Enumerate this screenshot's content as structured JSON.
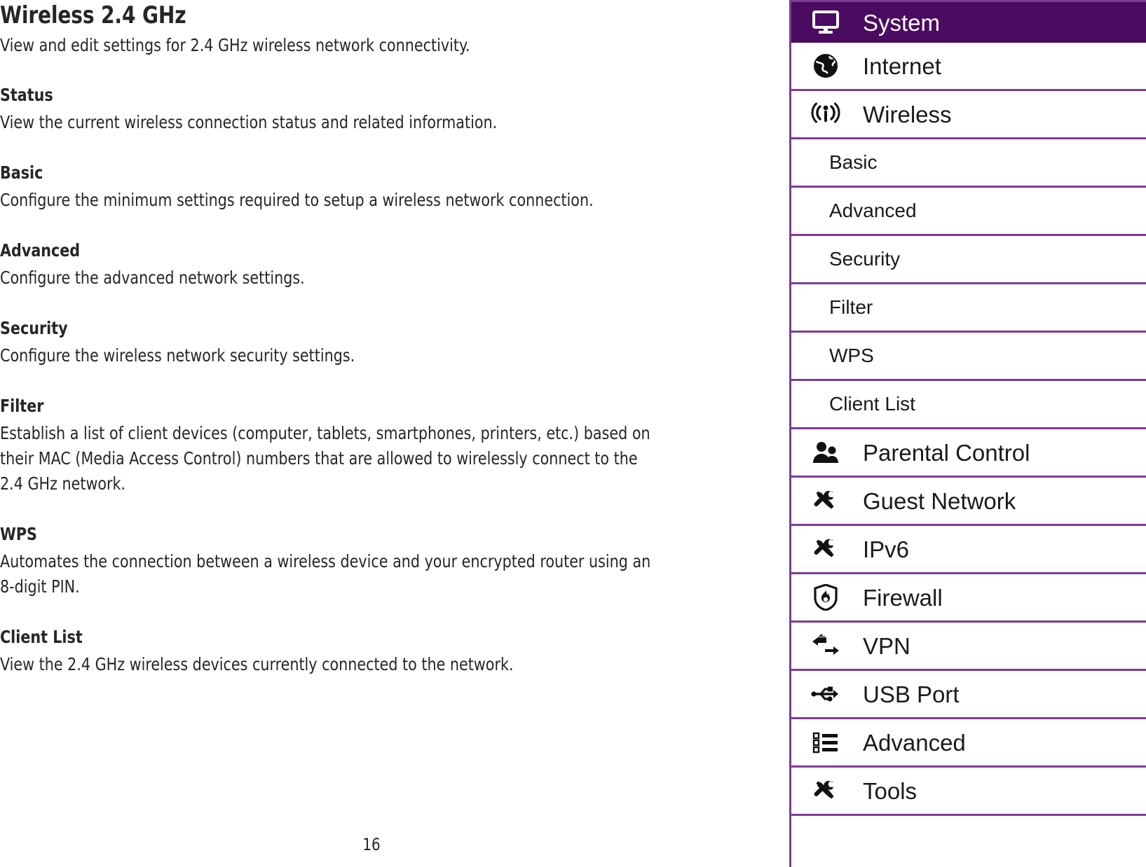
{
  "document": {
    "title": "Wireless 2.4 GHz",
    "intro": "View and edit settings for 2.4 GHz wireless network connectivity.",
    "page_number": "16",
    "sections": [
      {
        "heading": "Status",
        "body": "View the current wireless connection status and related information."
      },
      {
        "heading": "Basic",
        "body": "Configure the minimum settings required to setup a wireless network connection."
      },
      {
        "heading": "Advanced",
        "body": "Configure the advanced network settings."
      },
      {
        "heading": "Security",
        "body": "Configure the wireless network security settings."
      },
      {
        "heading": "Filter",
        "body": "Establish a list of client devices (computer, tablets, smartphones, printers, etc.) based on their MAC (Media Access Control) numbers that are allowed to wirelessly connect to the 2.4 GHz network."
      },
      {
        "heading": "WPS",
        "body": "Automates the connection between a wireless device and your encrypted router using an 8-digit PIN."
      },
      {
        "heading": "Client List",
        "body": "View the 2.4 GHz wireless devices currently connected to the network."
      }
    ]
  },
  "menu": {
    "accent_color": "#7E3C94",
    "active_color": "#4A0B60",
    "active_text_color": "#FFFFFF",
    "items": [
      {
        "label": "System",
        "icon": "monitor-icon",
        "level": "top",
        "active": true
      },
      {
        "label": "Internet",
        "icon": "globe-icon",
        "level": "top",
        "active": false
      },
      {
        "label": "Wireless",
        "icon": "wifi-signal-icon",
        "level": "top",
        "active": false
      },
      {
        "label": "Basic",
        "icon": null,
        "level": "sub",
        "active": false
      },
      {
        "label": "Advanced",
        "icon": null,
        "level": "sub",
        "active": false
      },
      {
        "label": "Security",
        "icon": null,
        "level": "sub",
        "active": false
      },
      {
        "label": "Filter",
        "icon": null,
        "level": "sub",
        "active": false
      },
      {
        "label": "WPS",
        "icon": null,
        "level": "sub",
        "active": false
      },
      {
        "label": "Client List",
        "icon": null,
        "level": "sub",
        "active": false
      },
      {
        "label": "Parental Control",
        "icon": "people-icon",
        "level": "top",
        "active": false
      },
      {
        "label": "Guest Network",
        "icon": "tools-icon",
        "level": "top",
        "active": false
      },
      {
        "label": "IPv6",
        "icon": "tools-icon",
        "level": "top",
        "active": false
      },
      {
        "label": "Firewall",
        "icon": "shield-flame-icon",
        "level": "top",
        "active": false
      },
      {
        "label": "VPN",
        "icon": "two-arrows-icon",
        "level": "top",
        "active": false
      },
      {
        "label": "USB Port",
        "icon": "usb-icon",
        "level": "top",
        "active": false
      },
      {
        "label": "Advanced",
        "icon": "bullet-list-icon",
        "level": "top",
        "active": false
      },
      {
        "label": "Tools",
        "icon": "tools-icon",
        "level": "top",
        "active": false
      }
    ]
  }
}
